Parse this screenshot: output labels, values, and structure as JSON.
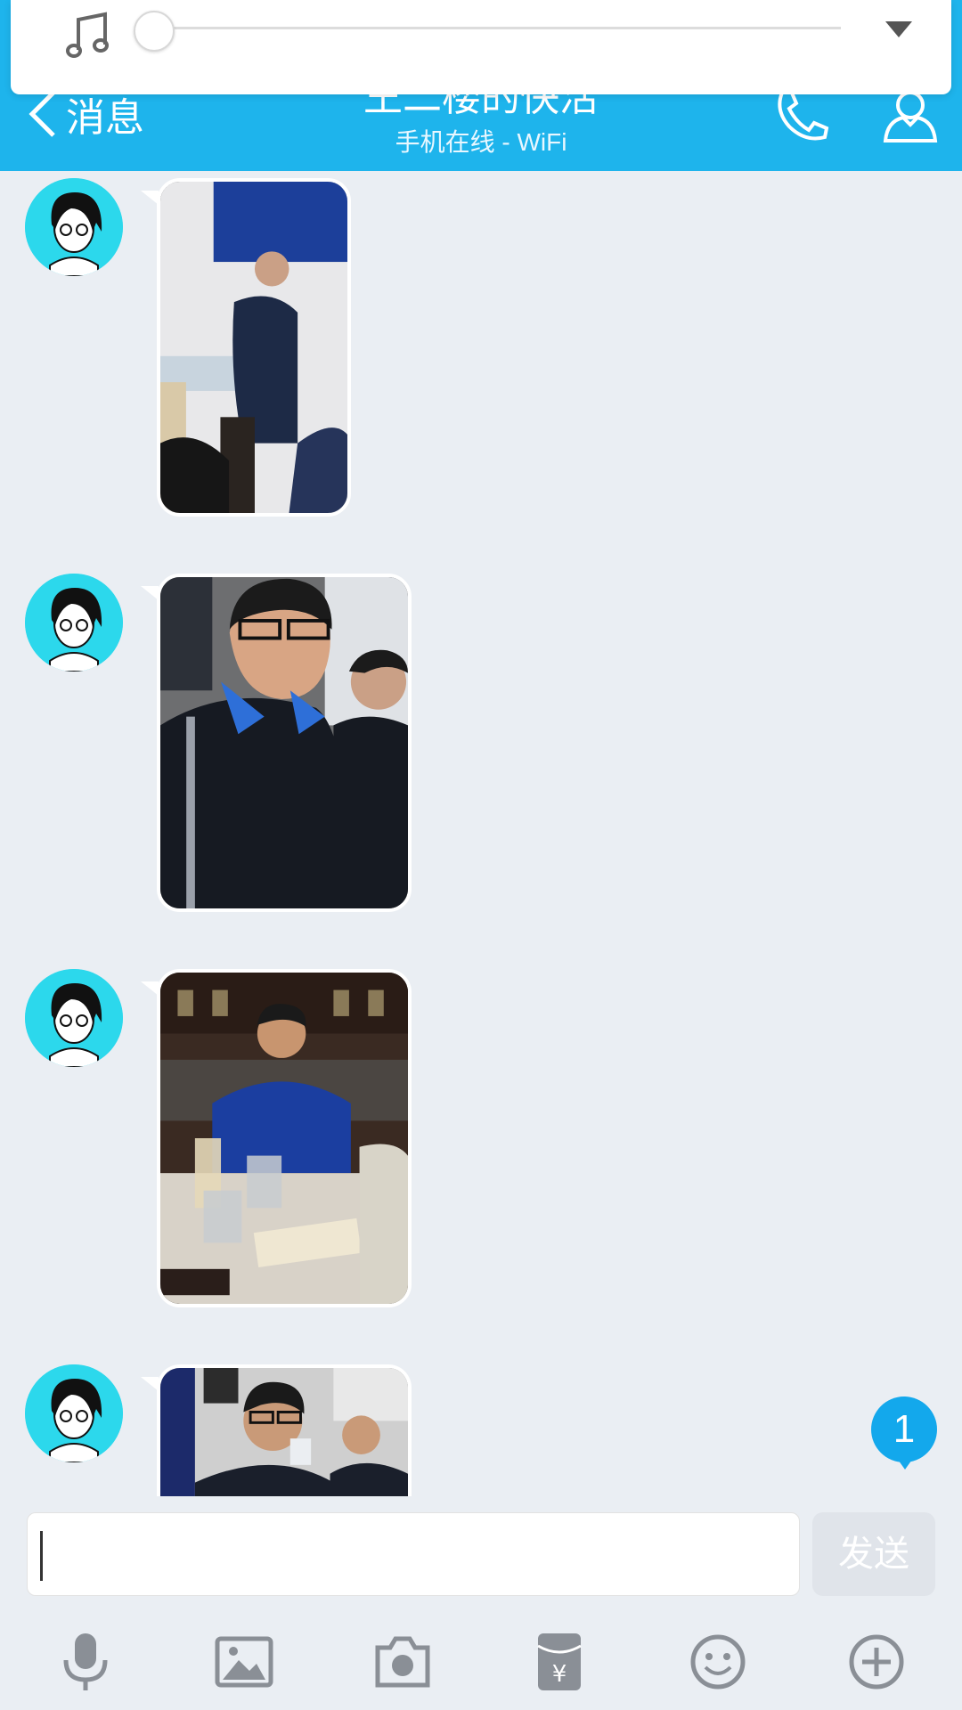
{
  "header": {
    "back_label": "消息",
    "title": "王二楼的快活",
    "subtitle": "手机在线 - WiFi",
    "accent_color": "#1eb4ec"
  },
  "music_popup": {
    "icon": "music-note-icon",
    "progress": 0,
    "dropdown_icon": "chevron-down-icon"
  },
  "messages": [
    {
      "type": "image",
      "avatar": "cartoon-avatar"
    },
    {
      "type": "image",
      "avatar": "cartoon-avatar"
    },
    {
      "type": "image",
      "avatar": "cartoon-avatar"
    },
    {
      "type": "image",
      "avatar": "cartoon-avatar"
    }
  ],
  "unread_badge": {
    "count": "1"
  },
  "input": {
    "value": "",
    "send_label": "发送"
  },
  "toolbar": {
    "items": [
      "microphone-icon",
      "image-icon",
      "camera-icon",
      "red-packet-icon",
      "emoji-icon",
      "plus-icon"
    ]
  }
}
